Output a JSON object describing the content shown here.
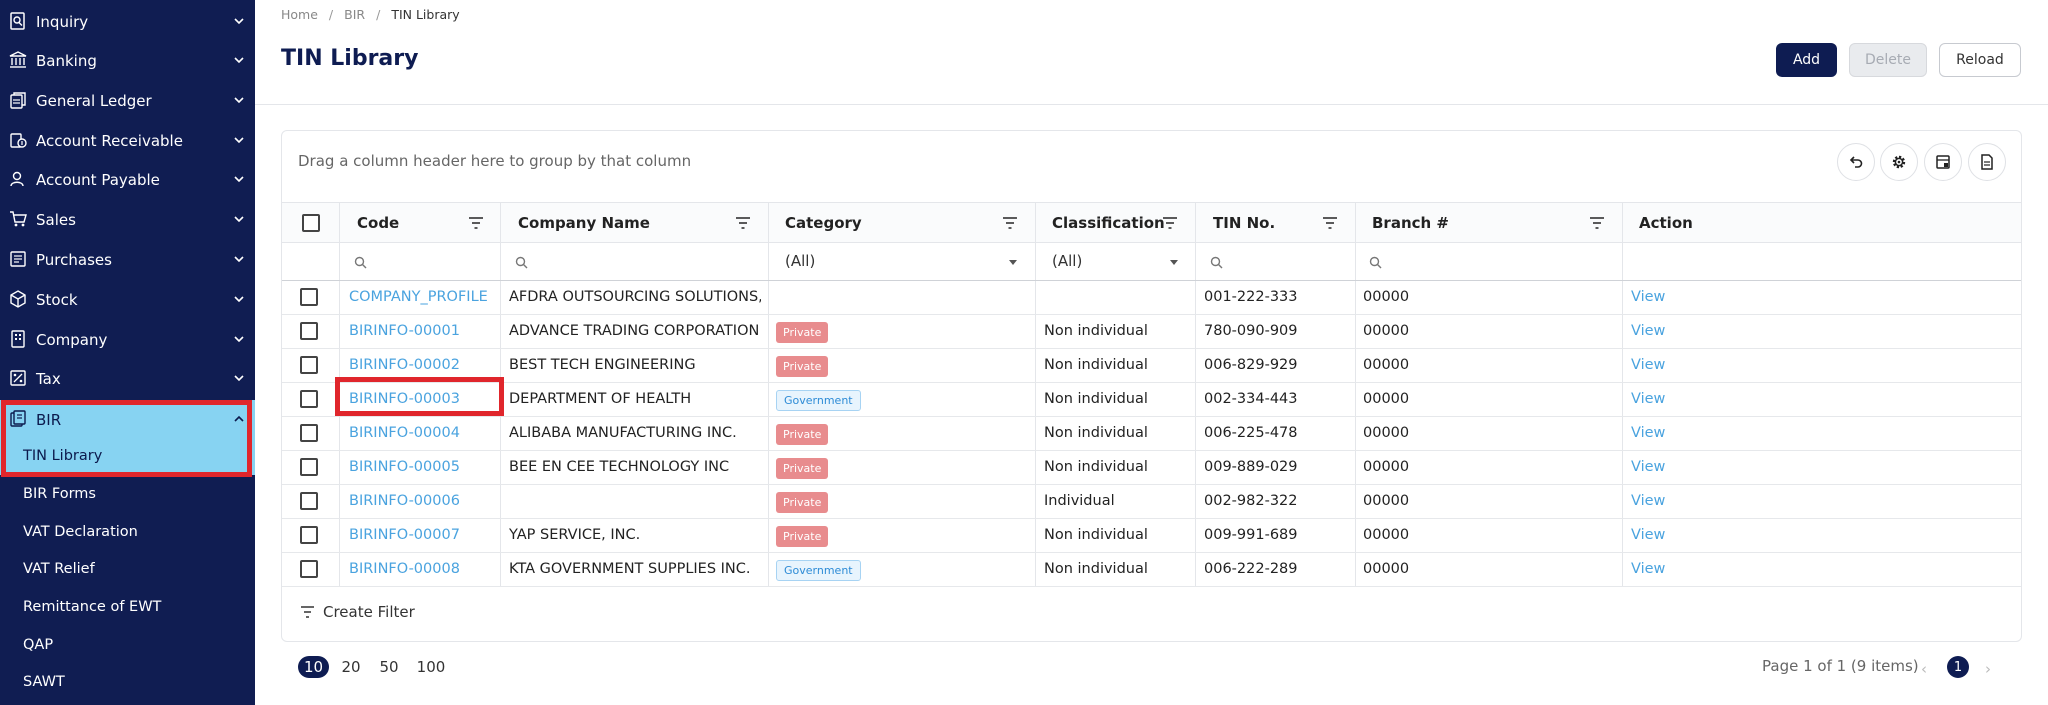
{
  "sidebar": {
    "items": [
      {
        "label": "Inquiry",
        "icon": "inquiry-icon"
      },
      {
        "label": "Banking",
        "icon": "bank-icon"
      },
      {
        "label": "General Ledger",
        "icon": "ledger-icon"
      },
      {
        "label": "Account Receivable",
        "icon": "receivable-icon"
      },
      {
        "label": "Account Payable",
        "icon": "payable-icon"
      },
      {
        "label": "Sales",
        "icon": "cart-icon"
      },
      {
        "label": "Purchases",
        "icon": "purchases-icon"
      },
      {
        "label": "Stock",
        "icon": "box-icon"
      },
      {
        "label": "Company",
        "icon": "company-icon"
      },
      {
        "label": "Tax",
        "icon": "tax-icon"
      },
      {
        "label": "BIR",
        "icon": "bir-icon"
      }
    ],
    "bir_subitems": [
      "TIN Library",
      "BIR Forms",
      "VAT Declaration",
      "VAT Relief",
      "Remittance of EWT",
      "QAP",
      "SAWT"
    ]
  },
  "breadcrumb": {
    "home": "Home",
    "section": "BIR",
    "current": "TIN Library"
  },
  "page": {
    "title": "TIN Library"
  },
  "toolbar": {
    "add_label": "Add",
    "delete_label": "Delete",
    "reload_label": "Reload"
  },
  "grid": {
    "group_hint": "Drag a column header here to group by that column",
    "columns": [
      "Code",
      "Company Name",
      "Category",
      "Classification",
      "TIN No.",
      "Branch #",
      "Action"
    ],
    "filters": {
      "category": "(All)",
      "classification": "(All)"
    },
    "rows": [
      {
        "code": "COMPANY_PROFILE",
        "company": "AFDRA OUTSOURCING SOLUTIONS, I...",
        "category": "",
        "classification": "",
        "tin": "001-222-333",
        "branch": "00000",
        "action": "View"
      },
      {
        "code": "BIRINFO-00001",
        "company": "ADVANCE TRADING CORPORATION",
        "category": "Private",
        "classification": "Non individual",
        "tin": "780-090-909",
        "branch": "00000",
        "action": "View"
      },
      {
        "code": "BIRINFO-00002",
        "company": "BEST TECH ENGINEERING",
        "category": "Private",
        "classification": "Non individual",
        "tin": "006-829-929",
        "branch": "00000",
        "action": "View"
      },
      {
        "code": "BIRINFO-00003",
        "company": "DEPARTMENT OF HEALTH",
        "category": "Government",
        "classification": "Non individual",
        "tin": "002-334-443",
        "branch": "00000",
        "action": "View"
      },
      {
        "code": "BIRINFO-00004",
        "company": "ALIBABA MANUFACTURING INC.",
        "category": "Private",
        "classification": "Non individual",
        "tin": "006-225-478",
        "branch": "00000",
        "action": "View"
      },
      {
        "code": "BIRINFO-00005",
        "company": "BEE EN CEE TECHNOLOGY INC",
        "category": "Private",
        "classification": "Non individual",
        "tin": "009-889-029",
        "branch": "00000",
        "action": "View"
      },
      {
        "code": "BIRINFO-00006",
        "company": "",
        "category": "Private",
        "classification": "Individual",
        "tin": "002-982-322",
        "branch": "00000",
        "action": "View"
      },
      {
        "code": "BIRINFO-00007",
        "company": "YAP SERVICE, INC.",
        "category": "Private",
        "classification": "Non individual",
        "tin": "009-991-689",
        "branch": "00000",
        "action": "View"
      },
      {
        "code": "BIRINFO-00008",
        "company": "KTA GOVERNMENT SUPPLIES INC.",
        "category": "Government",
        "classification": "Non individual",
        "tin": "006-222-289",
        "branch": "00000",
        "action": "View"
      }
    ],
    "create_filter_label": "Create Filter"
  },
  "pagination": {
    "page_sizes": [
      "10",
      "20",
      "50",
      "100"
    ],
    "selected_size": "10",
    "info": "Page 1 of 1 (9 items)",
    "current_page": "1",
    "prev": "‹",
    "next": "›"
  }
}
